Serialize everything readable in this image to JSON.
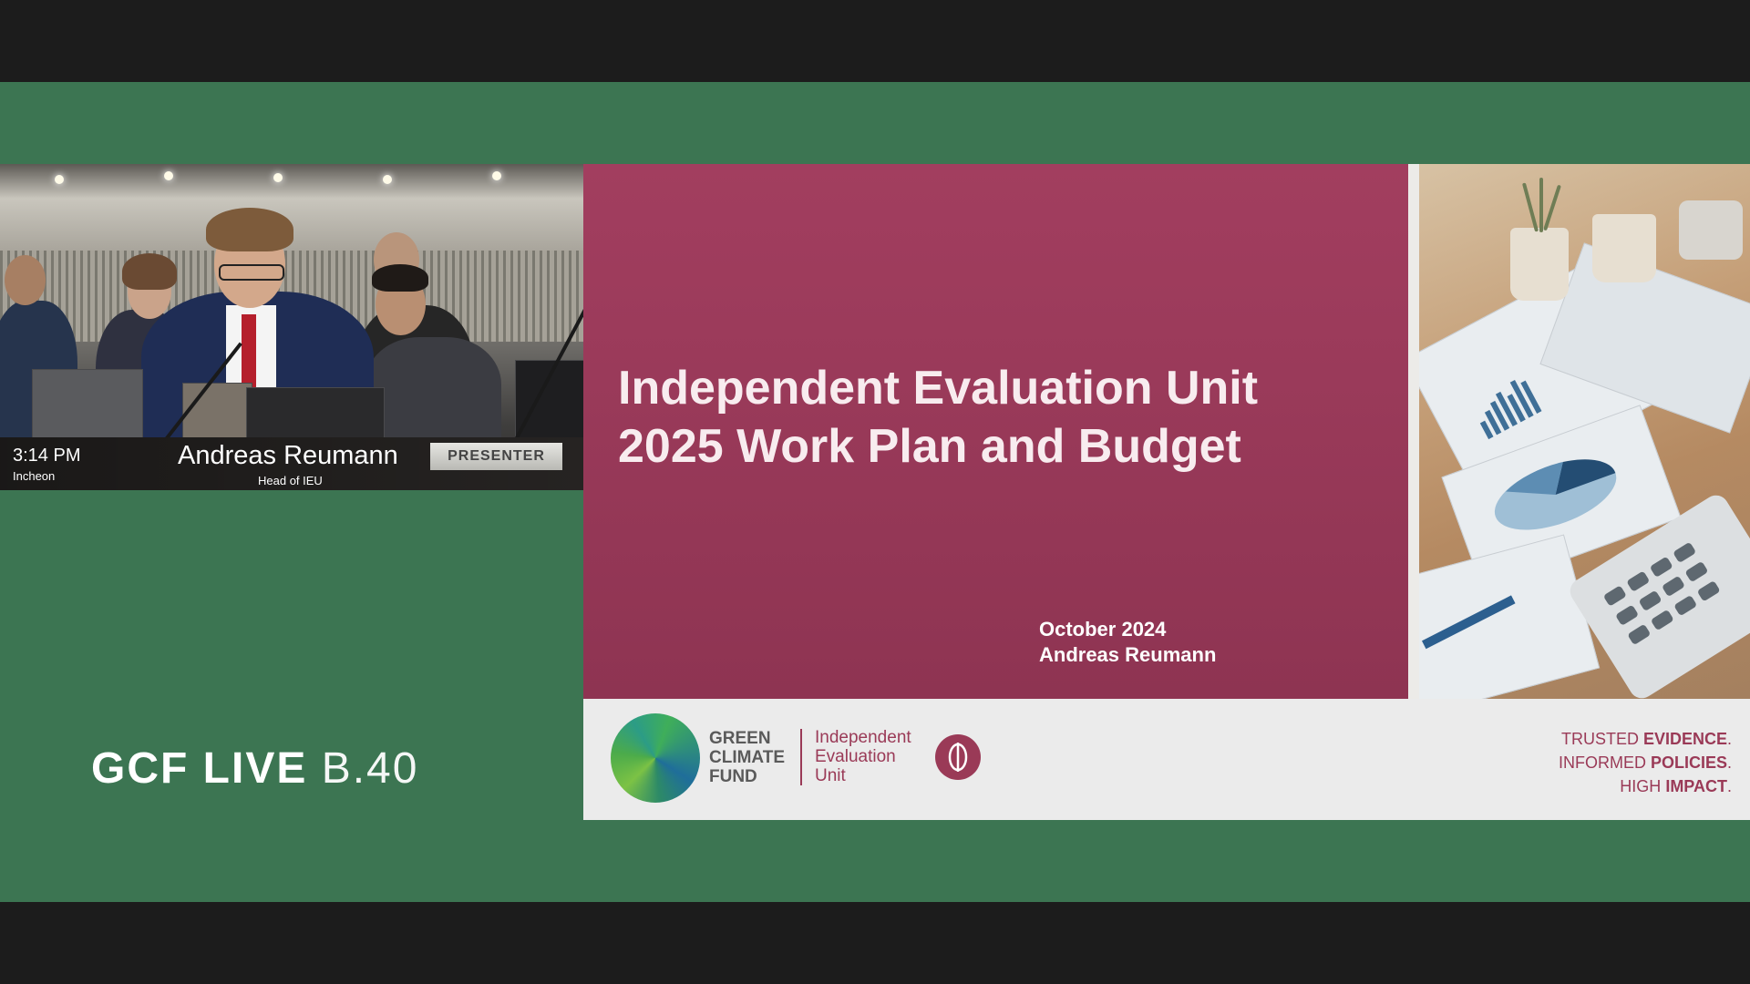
{
  "camera": {
    "time": "3:14 PM",
    "location": "Incheon",
    "speaker_name": "Andreas Reumann",
    "speaker_title": "Head of IEU",
    "badge": "PRESENTER"
  },
  "brand": {
    "strong": "GCF LIVE",
    "light": "B.40"
  },
  "slide": {
    "title_line1": "Independent Evaluation Unit",
    "title_line2": "2025 Work Plan and Budget",
    "date": "October 2024",
    "presenter": "Andreas Reumann",
    "gcf_line1": "GREEN",
    "gcf_line2": "CLIMATE",
    "gcf_line3": "FUND",
    "ieu_line1": "Independent",
    "ieu_line2": "Evaluation",
    "ieu_line3": "Unit",
    "tagline": [
      {
        "prefix": "TRUSTED ",
        "bold": "EVIDENCE",
        "suffix": "."
      },
      {
        "prefix": "INFORMED ",
        "bold": "POLICIES",
        "suffix": "."
      },
      {
        "prefix": "HIGH ",
        "bold": "IMPACT",
        "suffix": "."
      }
    ]
  },
  "colors": {
    "stage_green": "#3c7552",
    "slide_maroon": "#a23e5f",
    "accent_maroon": "#9a3a57",
    "letterbox": "#1c1c1c"
  }
}
